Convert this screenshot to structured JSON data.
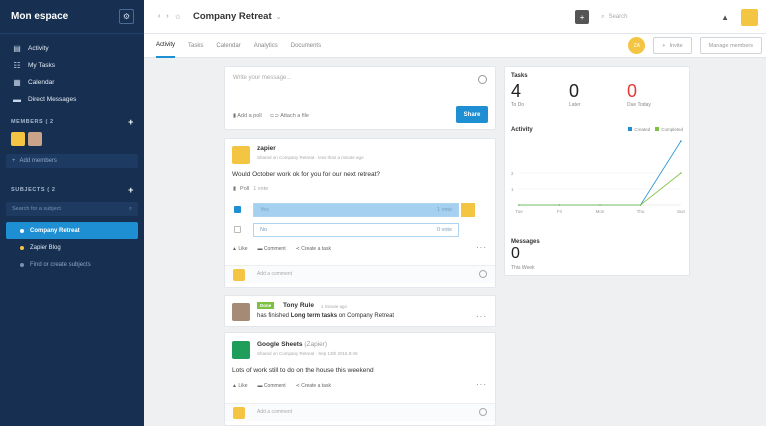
{
  "sidebar": {
    "workspace": "Mon espace",
    "nav": [
      {
        "label": "Activity",
        "icon": "activity-icon",
        "glyph": "▤"
      },
      {
        "label": "My Tasks",
        "icon": "tasks-icon",
        "glyph": "☷"
      },
      {
        "label": "Calendar",
        "icon": "calendar-icon",
        "glyph": "▦"
      },
      {
        "label": "Direct Messages",
        "icon": "message-icon",
        "glyph": "▬"
      }
    ],
    "members_header": "MEMBERS ( 2",
    "add_members": "Add members",
    "subjects_header": "SUBJECTS ( 2",
    "search_placeholder": "Search for a subject",
    "subjects": [
      {
        "label": "Company Retreat",
        "active": true,
        "color": "#ffffff"
      },
      {
        "label": "Zapier Blog",
        "active": false,
        "color": "#f4c542"
      },
      {
        "label": "Find or create subjects",
        "active": false,
        "color": "#7991b0"
      }
    ]
  },
  "topbar": {
    "title": "Company Retreat",
    "search_placeholder": "Search"
  },
  "tabs": [
    "Activity",
    "Tasks",
    "Calendar",
    "Analytics",
    "Documents"
  ],
  "tabs_right": {
    "avatar": "ZA",
    "invite": "Invite",
    "manage": "Manage members"
  },
  "composer": {
    "placeholder": "Write your message...",
    "add_poll": "Add a poll",
    "attach": "Attach a file",
    "share": "Share"
  },
  "post1": {
    "author": "zapier",
    "meta": "Shared on Company Retreat · less than a minute ago",
    "text": "Would October work ok for you for our next retreat?",
    "poll_label": "Poll",
    "poll_votes": "1 vote",
    "options": [
      {
        "label": "Yes",
        "votes": "1 vote",
        "fraction": 1.0
      },
      {
        "label": "No",
        "votes": "0 vote",
        "fraction": 0.0
      }
    ],
    "like": "Like",
    "comment": "Comment",
    "task": "Create a task",
    "comment_placeholder": "Add a comment"
  },
  "post2": {
    "badge": "Done",
    "author": "Tony Rule",
    "time": "1 minute ago",
    "text_prefix": "has finished ",
    "text_bold": "Long term tasks",
    "text_suffix": " on Company Retreat"
  },
  "post3": {
    "author": "Google Sheets",
    "author_suffix": "(Zapier)",
    "meta": "Shared on Company Retreat · Sep 13th 2015 8:46",
    "text": "Lots of work still to do on the house this weekend",
    "like": "Like",
    "comment": "Comment",
    "task": "Create a task",
    "comment_placeholder": "Add a comment"
  },
  "tasks_panel": {
    "title": "Tasks",
    "stats": [
      {
        "value": "4",
        "label": "To Do",
        "color": "#222222"
      },
      {
        "value": "0",
        "label": "Later",
        "color": "#222222"
      },
      {
        "value": "0",
        "label": "Due Today",
        "color": "#e53935"
      }
    ],
    "activity_title": "Activity",
    "legend": [
      {
        "label": "Created",
        "color": "#1f8fd3"
      },
      {
        "label": "Completed",
        "color": "#7cc242"
      }
    ],
    "messages_title": "Messages",
    "messages_count": "0",
    "messages_label": "This Week"
  },
  "chart_data": {
    "type": "line",
    "categories": [
      "Tue",
      "Fri",
      "Mon",
      "Thu",
      "Sun"
    ],
    "ylim": [
      0,
      4
    ],
    "ytick_labels": [
      "1",
      "2"
    ],
    "series": [
      {
        "name": "Created",
        "values": [
          0,
          0,
          0,
          0,
          4
        ]
      },
      {
        "name": "Completed",
        "values": [
          0,
          0,
          0,
          0,
          2
        ]
      }
    ]
  }
}
